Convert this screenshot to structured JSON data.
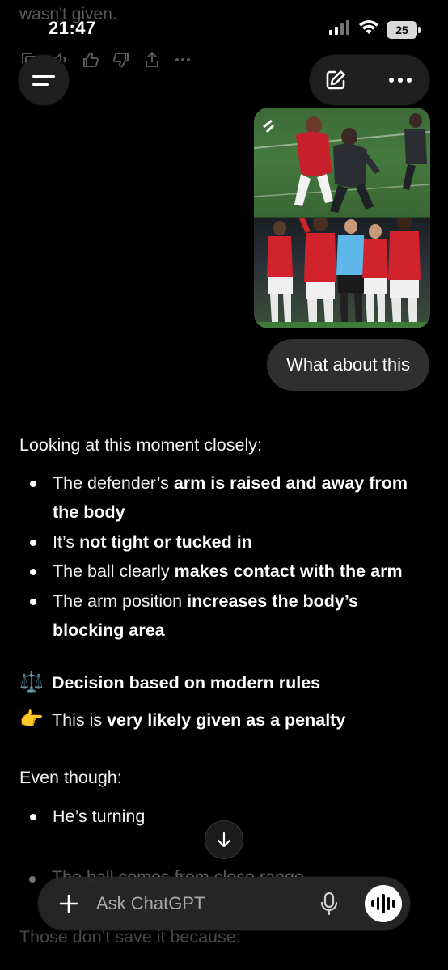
{
  "previous": {
    "tail_text": "wasn't given."
  },
  "status_bar": {
    "time": "21:47",
    "battery": "25"
  },
  "attachment": {
    "watermark": "⁄."
  },
  "user_message": "What about this",
  "response": {
    "intro": "Looking at this moment closely:",
    "bullets": [
      {
        "pre": "The defender’s ",
        "bold": "arm is raised and away from the body",
        "post": ""
      },
      {
        "pre": "It’s ",
        "bold": "not tight or tucked in",
        "post": ""
      },
      {
        "pre": "The ball clearly ",
        "bold": "makes contact with the arm",
        "post": ""
      },
      {
        "pre": "The arm position ",
        "bold": "increases the body’s blocking area",
        "post": ""
      }
    ],
    "decision_emoji": "⚖️",
    "decision": "Decision based on modern rules",
    "verdict_emoji": "👉",
    "verdict_pre": "This is ",
    "verdict_bold": "very likely given as a penalty",
    "even_though": "Even though:",
    "reasons": [
      {
        "text": "He’s turning"
      }
    ],
    "faded_reason": "The ball comes from close range",
    "faded_after": "Those don’t save it because:"
  },
  "composer": {
    "placeholder": "Ask ChatGPT"
  },
  "colors": {
    "background": "#000000",
    "surface": "#1f1f1f",
    "bubble": "#2f2f2f",
    "text": "#ffffff"
  }
}
